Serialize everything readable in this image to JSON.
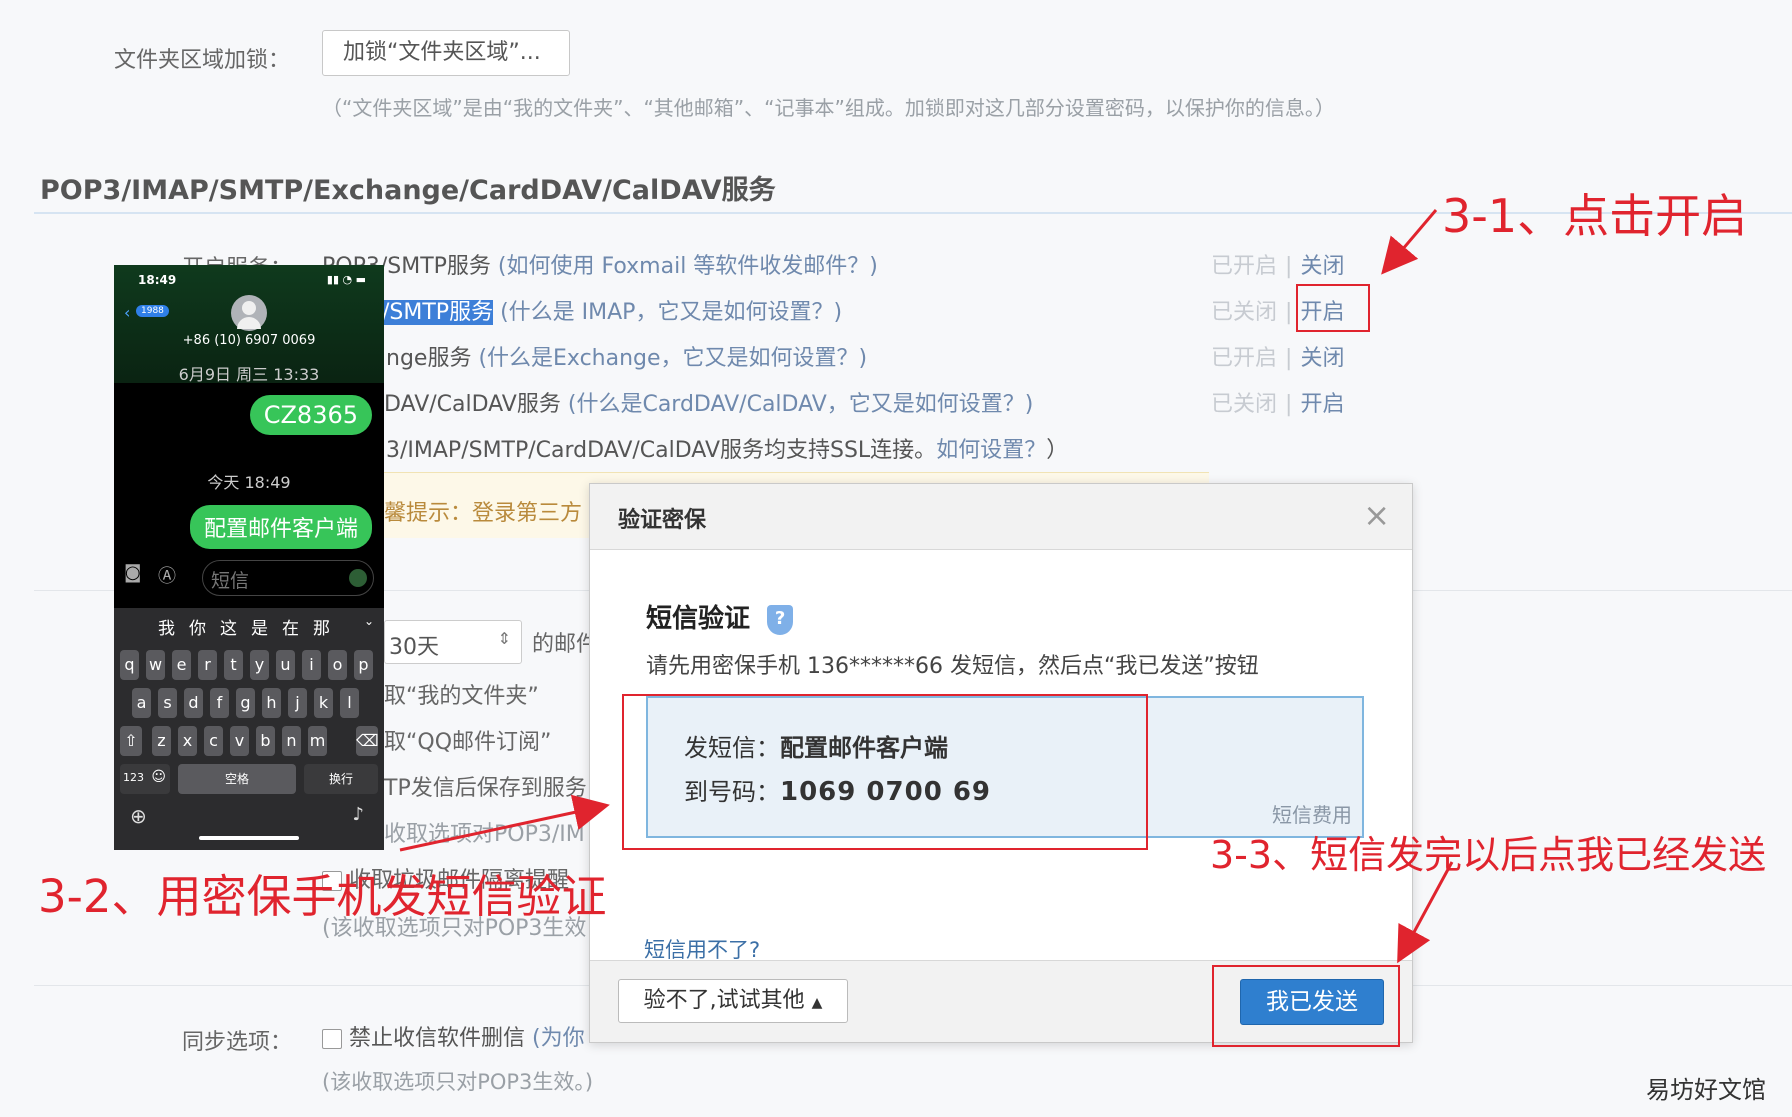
{
  "folder_lock": {
    "label": "文件夹区域加锁：",
    "button": "加锁“文件夹区域”...",
    "note": "（“文件夹区域”是由“我的文件夹”、“其他邮箱”、“记事本”组成。加锁即对这几部分设置密码，以保护你的信息。）"
  },
  "section_title": "POP3/IMAP/SMTP/Exchange/CardDAV/CalDAV服务",
  "services": {
    "label": "开启服务：",
    "rows": [
      {
        "name": "POP3/SMTP服务",
        "help": "(如何使用 Foxmail 等软件收发邮件？)",
        "status": "已开启",
        "action": "关闭"
      },
      {
        "name": "/SMTP服务",
        "help": "(什么是 IMAP，它又是如何设置？)",
        "status": "已关闭",
        "action": "开启"
      },
      {
        "name": "nge服务",
        "help": "(什么是Exchange，它又是如何设置？)",
        "status": "已开启",
        "action": "关闭"
      },
      {
        "name": "DAV/CalDAV服务",
        "help": "(什么是CardDAV/CalDAV，它又是如何设置？)",
        "status": "已关闭",
        "action": "开启"
      }
    ],
    "ssl_note_prefix": "3/IMAP/SMTP/CardDAV/CalDAV服务均支持SSL连接。",
    "ssl_note_link": "如何设置？",
    "ssl_note_suffix": "）",
    "tip": "馨提示：登录第三方"
  },
  "behind_modal": {
    "days_select": "30天",
    "days_suffix": "的邮件",
    "opt1": "取“我的文件夹”",
    "opt2": "取“QQ邮件订阅”",
    "opt3": "TP发信后保存到服务",
    "opt4": "收取选项对POP3/IM",
    "opt5": "收取垃圾邮件隔离提醒",
    "opt6": "(该收取选项只对POP3生效"
  },
  "sync": {
    "label": "同步选项：",
    "checkbox_label": "禁止收信软件删信",
    "checkbox_note": "(为你",
    "note": "(该收取选项只对POP3生效。)"
  },
  "phone": {
    "time": "18:49",
    "back_count": "1988",
    "number": "+86 (10) 6907 0069",
    "date1": "6月9日 周三 13:33",
    "msg1": "CZ8365",
    "date2": "今天 18:49",
    "msg2": "配置邮件客户端",
    "input_placeholder": "短信",
    "candidates": [
      "我",
      "你",
      "这",
      "是",
      "在",
      "那"
    ],
    "row1": [
      "q",
      "w",
      "e",
      "r",
      "t",
      "y",
      "u",
      "i",
      "o",
      "p"
    ],
    "row2": [
      "a",
      "s",
      "d",
      "f",
      "g",
      "h",
      "j",
      "k",
      "l"
    ],
    "row3": [
      "z",
      "x",
      "c",
      "v",
      "b",
      "n",
      "m"
    ],
    "key_123": "123",
    "key_space": "空格",
    "key_return": "换行"
  },
  "modal": {
    "title": "验证密保",
    "close": "×",
    "heading": "短信验证",
    "instruction": "请先用密保手机 136******66 发短信，然后点“我已发送”按钮",
    "sms_label": "发短信：",
    "sms_content": "配置邮件客户端",
    "to_label": "到号码：",
    "to_number": "1069 0700 69",
    "fee": "短信费用",
    "cant_use": "短信用不了?",
    "other_btn": "验不了,试试其他",
    "sent_btn": "我已发送"
  },
  "annotations": {
    "a1": "3-1、点击开启",
    "a2": "3-2、用密保手机发短信验证",
    "a3": "3-3、短信发完以后点我已经发送"
  },
  "watermark": "易坊好文馆",
  "colors": {
    "annotation_red": "#e0242e",
    "link_blue": "#6f89ad",
    "primary_btn": "#2f7fcf",
    "sms_green": "#37c559"
  }
}
